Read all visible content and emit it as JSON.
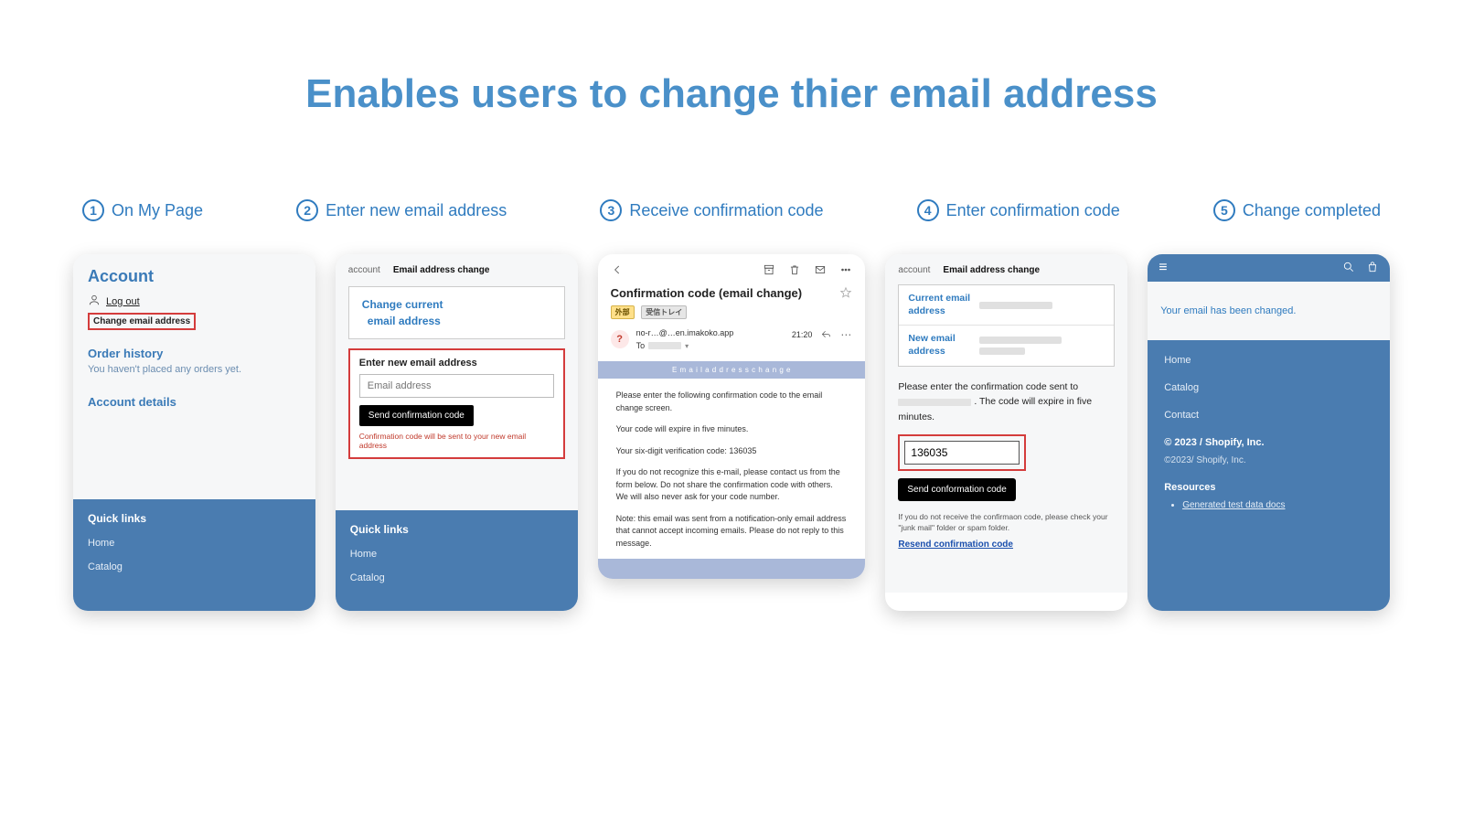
{
  "title": "Enables users to change thier email address",
  "steps": [
    {
      "num": "1",
      "label": "On My Page"
    },
    {
      "num": "2",
      "label": "Enter new email address"
    },
    {
      "num": "3",
      "label": "Receive confirmation code"
    },
    {
      "num": "4",
      "label": "Enter confirmation code"
    },
    {
      "num": "5",
      "label": "Change completed"
    }
  ],
  "card1": {
    "account": "Account",
    "logout": "Log out",
    "change_link": "Change email address",
    "order_history": "Order history",
    "order_none": "You haven't placed any orders yet.",
    "details": "Account details",
    "quick": "Quick links",
    "home": "Home",
    "catalog": "Catalog"
  },
  "card2": {
    "crumb_a": "account",
    "crumb_b": "Email address change",
    "box_l1": "Change current",
    "box_l2": "email address",
    "enter_label": "Enter new email address",
    "placeholder": "Email address",
    "send": "Send confirmation code",
    "note": "Confirmation code will be sent to your new email address",
    "quick": "Quick links",
    "home": "Home",
    "catalog": "Catalog"
  },
  "card3": {
    "subject": "Confirmation code (email change)",
    "tag1": "外部",
    "tag2": "受信トレイ",
    "from": "no-r…@…en.imakoko.app",
    "time": "21:20",
    "to_label": "To",
    "bar": "E m a i l   a d d r e s s   c h a n g e",
    "p1": "Please enter the following confirmation code to the email change screen.",
    "p2": "Your code will expire in five minutes.",
    "p3": "Your six-digit verification code: 136035",
    "p4": "If you do not recognize this e-mail, please contact us from the form below. Do not share the confirmation code with others. We will also never ask for your code number.",
    "p5": "Note: this email was sent from a notification-only email address that cannot accept incoming emails. Please do not reply to this message."
  },
  "card4": {
    "crumb_a": "account",
    "crumb_b": "Email address change",
    "current": "Current email address",
    "new": "New email address",
    "msg_a": "Please enter the confirmation code sent to",
    "msg_b": ". The code will expire in five minutes.",
    "code": "136035",
    "send": "Send conformation code",
    "note": "If you do not receive the confirmaon code, please check your \"junk mail\" folder or spam folder.",
    "resend": "Resend confirmation code"
  },
  "card5": {
    "changed": "Your email has been changed.",
    "home": "Home",
    "catalog": "Catalog",
    "contact": "Contact",
    "copy1": "© 2023 / Shopify, Inc.",
    "copy2": "©2023/ Shopify, Inc.",
    "resources": "Resources",
    "doc": "Generated test data docs"
  }
}
